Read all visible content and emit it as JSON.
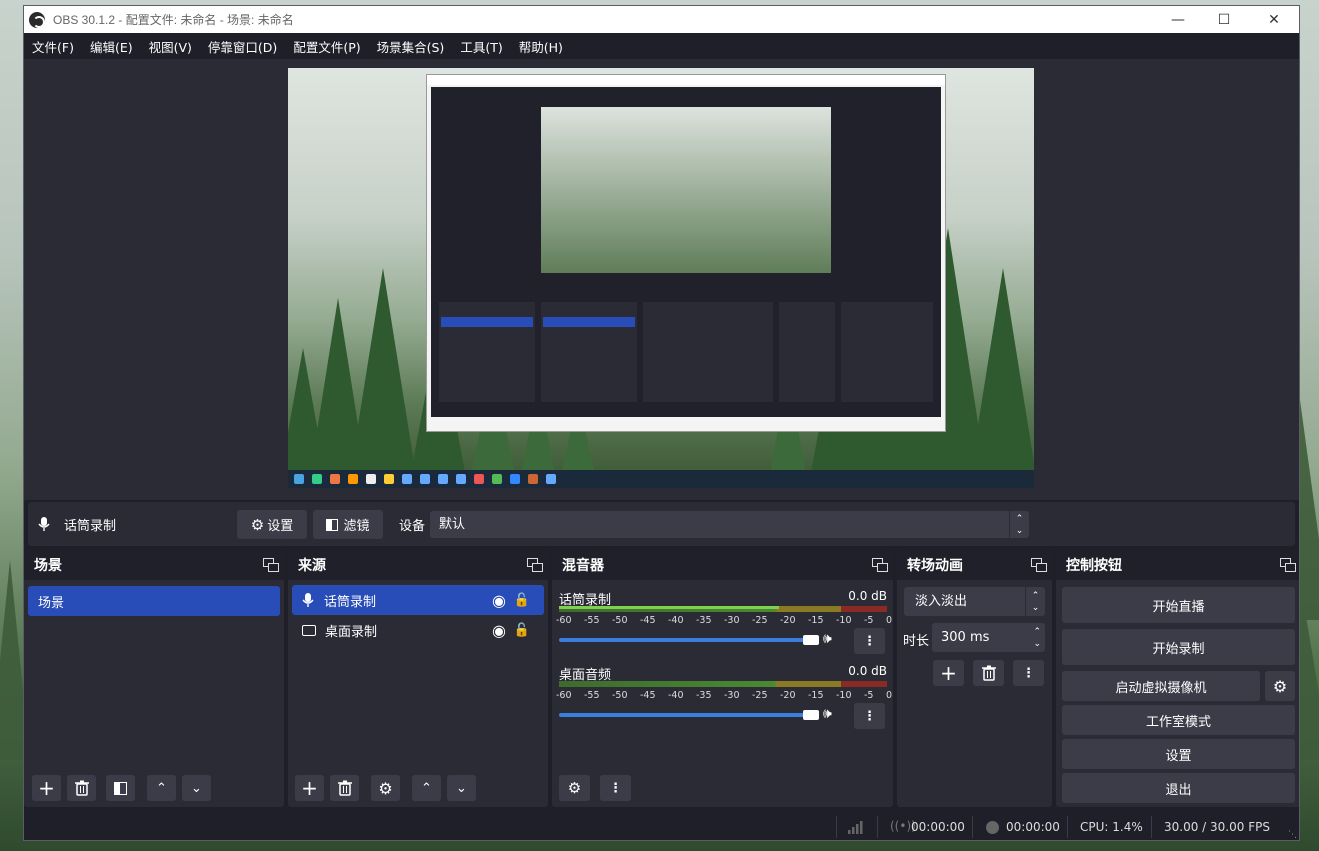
{
  "window": {
    "title": "OBS 30.1.2 - 配置文件: 未命名 - 场景: 未命名"
  },
  "menu": [
    {
      "label": "文件(F)"
    },
    {
      "label": "编辑(E)"
    },
    {
      "label": "视图(V)"
    },
    {
      "label": "停靠窗口(D)"
    },
    {
      "label": "配置文件(P)"
    },
    {
      "label": "场景集合(S)"
    },
    {
      "label": "工具(T)"
    },
    {
      "label": "帮助(H)"
    }
  ],
  "source_toolbar": {
    "source_name": "话筒录制",
    "properties_label": "设置",
    "filters_label": "滤镜",
    "device_label": "设备",
    "device_value": "默认"
  },
  "scenes": {
    "title": "场景",
    "items": [
      {
        "label": "场景",
        "selected": true
      }
    ]
  },
  "sources": {
    "title": "来源",
    "items": [
      {
        "label": "话筒录制",
        "icon": "microphone-icon",
        "selected": true
      },
      {
        "label": "桌面录制",
        "icon": "monitor-icon",
        "selected": false
      }
    ]
  },
  "mixer": {
    "title": "混音器",
    "channels": [
      {
        "name": "话筒录制",
        "db": "0.0 dB",
        "volume": 0.97
      },
      {
        "name": "桌面音频",
        "db": "0.0 dB",
        "volume": 0.97
      }
    ],
    "ticks": [
      "-60",
      "-55",
      "-50",
      "-45",
      "-40",
      "-35",
      "-30",
      "-25",
      "-20",
      "-15",
      "-10",
      "-5",
      "0"
    ]
  },
  "transitions": {
    "title": "转场动画",
    "selected": "淡入淡出",
    "duration_label": "时长",
    "duration_value": "300 ms"
  },
  "controls": {
    "title": "控制按钮",
    "start_stream": "开始直播",
    "start_record": "开始录制",
    "virtual_cam": "启动虚拟摄像机",
    "studio_mode": "工作室模式",
    "settings": "设置",
    "exit": "退出"
  },
  "status": {
    "stream_time": "00:00:00",
    "record_time": "00:00:00",
    "cpu": "CPU: 1.4%",
    "fps": "30.00 / 30.00 FPS"
  },
  "colors": {
    "accent": "#284cb8",
    "volume": "#3c7de0",
    "meter_green": "#4caf50",
    "meter_yellow": "#c8a92a",
    "meter_red": "#c0392b"
  }
}
